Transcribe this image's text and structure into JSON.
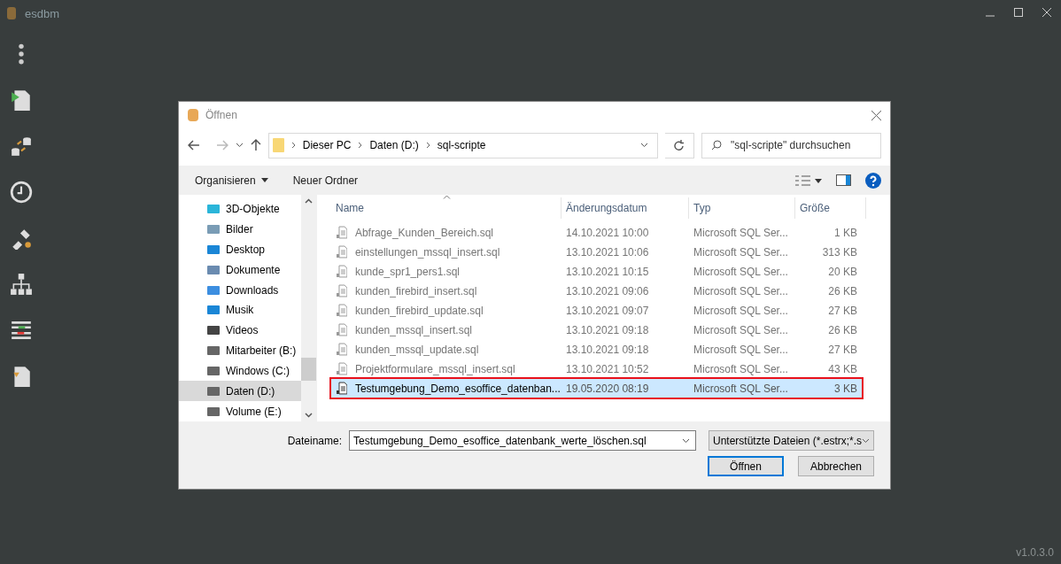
{
  "app": {
    "title": "esdbm",
    "version": "v1.0.3.0"
  },
  "dialog": {
    "title": "Öffnen",
    "breadcrumb": [
      "Dieser PC",
      "Daten (D:)",
      "sql-scripte"
    ],
    "search": {
      "placeholder": "\"sql-scripte\" durchsuchen"
    },
    "toolbar": [
      "Organisieren",
      "Neuer Ordner"
    ],
    "nav_items": [
      {
        "label": "3D-Objekte",
        "selected": false
      },
      {
        "label": "Bilder",
        "selected": false
      },
      {
        "label": "Desktop",
        "selected": false
      },
      {
        "label": "Dokumente",
        "selected": false
      },
      {
        "label": "Downloads",
        "selected": false
      },
      {
        "label": "Musik",
        "selected": false
      },
      {
        "label": "Videos",
        "selected": false
      },
      {
        "label": "Mitarbeiter (B:)",
        "selected": false
      },
      {
        "label": "Windows (C:)",
        "selected": false
      },
      {
        "label": "Daten (D:)",
        "selected": true
      },
      {
        "label": "Volume (E:)",
        "selected": false
      }
    ],
    "columns": [
      "Name",
      "Änderungsdatum",
      "Typ",
      "Größe"
    ],
    "files": [
      {
        "name": "Abfrage_Kunden_Bereich.sql",
        "date": "14.10.2021 10:00",
        "type": "Microsoft SQL Ser...",
        "size": "1 KB",
        "blurred": true,
        "selected": false
      },
      {
        "name": "einstellungen_mssql_insert.sql",
        "date": "13.10.2021 10:06",
        "type": "Microsoft SQL Ser...",
        "size": "313 KB",
        "blurred": true,
        "selected": false
      },
      {
        "name": "kunde_spr1_pers1.sql",
        "date": "13.10.2021 10:15",
        "type": "Microsoft SQL Ser...",
        "size": "20 KB",
        "blurred": true,
        "selected": false
      },
      {
        "name": "kunden_firebird_insert.sql",
        "date": "13.10.2021 09:06",
        "type": "Microsoft SQL Ser...",
        "size": "26 KB",
        "blurred": true,
        "selected": false
      },
      {
        "name": "kunden_firebird_update.sql",
        "date": "13.10.2021 09:07",
        "type": "Microsoft SQL Ser...",
        "size": "27 KB",
        "blurred": true,
        "selected": false
      },
      {
        "name": "kunden_mssql_insert.sql",
        "date": "13.10.2021 09:18",
        "type": "Microsoft SQL Ser...",
        "size": "26 KB",
        "blurred": true,
        "selected": false
      },
      {
        "name": "kunden_mssql_update.sql",
        "date": "13.10.2021 09:18",
        "type": "Microsoft SQL Ser...",
        "size": "27 KB",
        "blurred": true,
        "selected": false
      },
      {
        "name": "Projektformulare_mssql_insert.sql",
        "date": "13.10.2021 10:52",
        "type": "Microsoft SQL Ser...",
        "size": "43 KB",
        "blurred": true,
        "selected": false
      },
      {
        "name": "Testumgebung_Demo_esoffice_datenban...",
        "date": "19.05.2020 08:19",
        "type": "Microsoft SQL Ser...",
        "size": "3 KB",
        "blurred": false,
        "selected": true
      }
    ],
    "filename_label": "Dateiname:",
    "filename": "Testumgebung_Demo_esoffice_datenbank_werte_löschen.sql",
    "filetype": "Unterstützte Dateien (*.estrx;*.s",
    "buttons": [
      "Öffnen",
      "Abbrechen"
    ]
  }
}
